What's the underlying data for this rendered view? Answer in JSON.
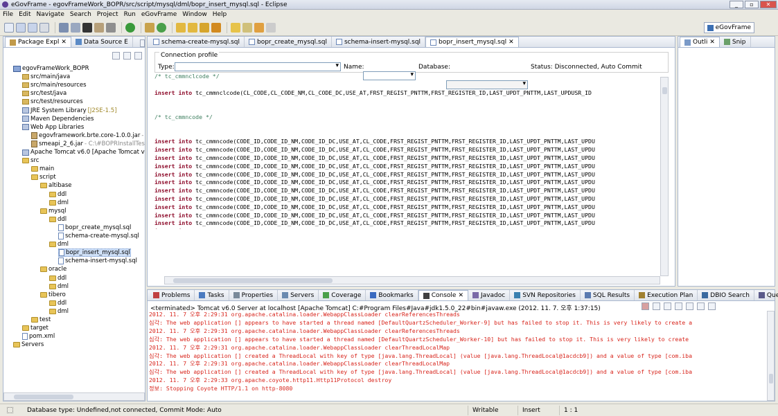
{
  "window": {
    "title": "eGovFrame - egovFrameWork_BOPR/src/script/mysql/dml/bopr_insert_mysql.sql - Eclipse"
  },
  "menu": [
    "File",
    "Edit",
    "Navigate",
    "Search",
    "Project",
    "Run",
    "eGovFrame",
    "Window",
    "Help"
  ],
  "perspective": {
    "label": "eGovFrame"
  },
  "package_explorer": {
    "tabs": [
      "Package Expl",
      "Data Source E"
    ],
    "tree": [
      {
        "label": "egovFrameWork_BOPR",
        "kind": "proj",
        "depth": 0
      },
      {
        "label": "src/main/java",
        "kind": "pkgf",
        "depth": 1
      },
      {
        "label": "src/main/resources",
        "kind": "pkgf",
        "depth": 1
      },
      {
        "label": "src/test/java",
        "kind": "pkgf",
        "depth": 1
      },
      {
        "label": "src/test/resources",
        "kind": "pkgf",
        "depth": 1
      },
      {
        "label": "JRE System Library",
        "suffix": "[J2SE-1.5]",
        "kind": "lib",
        "depth": 1
      },
      {
        "label": "Maven Dependencies",
        "kind": "lib",
        "depth": 1
      },
      {
        "label": "Web App Libraries",
        "kind": "lib",
        "depth": 1
      },
      {
        "label": "egovframework.brte.core-1.0.0.jar",
        "suffix": "- C:",
        "kind": "jar",
        "depth": 2
      },
      {
        "label": "smeapi_2_6.jar",
        "suffix": "- C:\\#BOPRInstallTest2#",
        "kind": "jar",
        "depth": 2
      },
      {
        "label": "Apache Tomcat v6.0 [Apache Tomcat v6.0",
        "kind": "lib",
        "depth": 1
      },
      {
        "label": "src",
        "kind": "folder",
        "depth": 1
      },
      {
        "label": "main",
        "kind": "folder",
        "depth": 2
      },
      {
        "label": "script",
        "kind": "folder",
        "depth": 2
      },
      {
        "label": "altibase",
        "kind": "folder",
        "depth": 3
      },
      {
        "label": "ddl",
        "kind": "folder",
        "depth": 4
      },
      {
        "label": "dml",
        "kind": "folder",
        "depth": 4
      },
      {
        "label": "mysql",
        "kind": "folder",
        "depth": 3
      },
      {
        "label": "ddl",
        "kind": "folder",
        "depth": 4
      },
      {
        "label": "bopr_create_mysql.sql",
        "kind": "sql",
        "depth": 5
      },
      {
        "label": "schema-create-mysql.sql",
        "kind": "sql",
        "depth": 5
      },
      {
        "label": "dml",
        "kind": "folder",
        "depth": 4
      },
      {
        "label": "bopr_insert_mysql.sql",
        "kind": "sql",
        "depth": 5,
        "selected": true
      },
      {
        "label": "schema-insert-mysql.sql",
        "kind": "sql",
        "depth": 5
      },
      {
        "label": "oracle",
        "kind": "folder",
        "depth": 3
      },
      {
        "label": "ddl",
        "kind": "folder",
        "depth": 4
      },
      {
        "label": "dml",
        "kind": "folder",
        "depth": 4
      },
      {
        "label": "tibero",
        "kind": "folder",
        "depth": 3
      },
      {
        "label": "ddl",
        "kind": "folder",
        "depth": 4
      },
      {
        "label": "dml",
        "kind": "folder",
        "depth": 4
      },
      {
        "label": "test",
        "kind": "folder",
        "depth": 2
      },
      {
        "label": "target",
        "kind": "folder",
        "depth": 1
      },
      {
        "label": "pom.xml",
        "kind": "sql",
        "depth": 1
      },
      {
        "label": "Servers",
        "kind": "folder",
        "depth": 0
      }
    ]
  },
  "editor": {
    "tabs": [
      "schema-create-mysql.sql",
      "bopr_create_mysql.sql",
      "schema-insert-mysql.sql",
      "bopr_insert_mysql.sql"
    ],
    "active_tab": 3,
    "connection": {
      "group_label": "Connection profile",
      "type_label": "Type:",
      "name_label": "Name:",
      "database_label": "Database:",
      "status": "Status: Disconnected, Auto Commit"
    },
    "code": [
      {
        "t": "cm",
        "s": "/* tc_cmmnclcode */"
      },
      {
        "t": "",
        "s": ""
      },
      {
        "t": "ins",
        "s": "tc_cmmnclcode(CL_CODE,CL_CODE_NM,CL_CODE_DC,USE_AT,FRST_REGIST_PNTTM,FRST_REGISTER_ID,LAST_UPDT_PNTTM,LAST_UPDUSR_ID"
      },
      {
        "t": "",
        "s": ""
      },
      {
        "t": "",
        "s": ""
      },
      {
        "t": "cm",
        "s": "/* tc_cmmncode */"
      },
      {
        "t": "",
        "s": ""
      },
      {
        "t": "",
        "s": ""
      },
      {
        "t": "ins",
        "s": "tc_cmmncode(CODE_ID,CODE_ID_NM,CODE_ID_DC,USE_AT,CL_CODE,FRST_REGIST_PNTTM,FRST_REGISTER_ID,LAST_UPDT_PNTTM,LAST_UPDU"
      },
      {
        "t": "ins",
        "s": "tc_cmmncode(CODE_ID,CODE_ID_NM,CODE_ID_DC,USE_AT,CL_CODE,FRST_REGIST_PNTTM,FRST_REGISTER_ID,LAST_UPDT_PNTTM,LAST_UPDU"
      },
      {
        "t": "ins",
        "s": "tc_cmmncode(CODE_ID,CODE_ID_NM,CODE_ID_DC,USE_AT,CL_CODE,FRST_REGIST_PNTTM,FRST_REGISTER_ID,LAST_UPDT_PNTTM,LAST_UPDU"
      },
      {
        "t": "ins",
        "s": "tc_cmmncode(CODE_ID,CODE_ID_NM,CODE_ID_DC,USE_AT,CL_CODE,FRST_REGIST_PNTTM,FRST_REGISTER_ID,LAST_UPDT_PNTTM,LAST_UPDU"
      },
      {
        "t": "ins",
        "s": "tc_cmmncode(CODE_ID,CODE_ID_NM,CODE_ID_DC,USE_AT,CL_CODE,FRST_REGIST_PNTTM,FRST_REGISTER_ID,LAST_UPDT_PNTTM,LAST_UPDU"
      },
      {
        "t": "ins",
        "s": "tc_cmmncode(CODE_ID,CODE_ID_NM,CODE_ID_DC,USE_AT,CL_CODE,FRST_REGIST_PNTTM,FRST_REGISTER_ID,LAST_UPDT_PNTTM,LAST_UPDU"
      },
      {
        "t": "ins",
        "s": "tc_cmmncode(CODE_ID,CODE_ID_NM,CODE_ID_DC,USE_AT,CL_CODE,FRST_REGIST_PNTTM,FRST_REGISTER_ID,LAST_UPDT_PNTTM,LAST_UPDU"
      },
      {
        "t": "ins",
        "s": "tc_cmmncode(CODE_ID,CODE_ID_NM,CODE_ID_DC,USE_AT,CL_CODE,FRST_REGIST_PNTTM,FRST_REGISTER_ID,LAST_UPDT_PNTTM,LAST_UPDU"
      },
      {
        "t": "ins",
        "s": "tc_cmmncode(CODE_ID,CODE_ID_NM,CODE_ID_DC,USE_AT,CL_CODE,FRST_REGIST_PNTTM,FRST_REGISTER_ID,LAST_UPDT_PNTTM,LAST_UPDU"
      },
      {
        "t": "ins",
        "s": "tc_cmmncode(CODE_ID,CODE_ID_NM,CODE_ID_DC,USE_AT,CL_CODE,FRST_REGIST_PNTTM,FRST_REGISTER_ID,LAST_UPDT_PNTTM,LAST_UPDU"
      },
      {
        "t": "ins",
        "s": "tc_cmmncode(CODE_ID,CODE_ID_NM,CODE_ID_DC,USE_AT,CL_CODE,FRST_REGIST_PNTTM,FRST_REGISTER_ID,LAST_UPDT_PNTTM,LAST_UPDU"
      },
      {
        "t": "ins",
        "s": "tc_cmmncode(CODE_ID,CODE_ID_NM,CODE_ID_DC,USE_AT,CL_CODE,FRST_REGIST_PNTTM,FRST_REGISTER_ID,LAST_UPDT_PNTTM,LAST_UPDU"
      },
      {
        "t": "ins",
        "s": "tc_cmmncode(CODE_ID,CODE_ID_NM,CODE_ID_DC,USE_AT,CL_CODE,FRST_REGIST_PNTTM,FRST_REGISTER_ID,LAST_UPDT_PNTTM,LAST_UPDU"
      },
      {
        "t": "ins",
        "s": "tc_cmmncode(CODE_ID,CODE_ID_NM,CODE_ID_DC,USE_AT,CL_CODE,FRST_REGIST_PNTTM,FRST_REGISTER_ID,LAST_UPDT_PNTTM,LAST_UPDU"
      },
      {
        "t": "ins",
        "s": "tc_cmmncode(CODE_ID,CODE_ID_NM,CODE_ID_DC,USE_AT,CL_CODE,FRST_REGIST_PNTTM,FRST_REGISTER_ID,LAST_UPDT_PNTTM,LAST_UPDU"
      }
    ],
    "keyword": "insert into"
  },
  "outline": {
    "tabs": [
      "Outli",
      "Snip"
    ]
  },
  "bottom": {
    "tabs": [
      "Problems",
      "Tasks",
      "Properties",
      "Servers",
      "Coverage",
      "Bookmarks",
      "Console",
      "Javadoc",
      "SVN Repositories",
      "SQL Results",
      "Execution Plan",
      "DBIO Search",
      "Query Result"
    ],
    "active_tab": 6,
    "console_header": "<terminated> Tomcat v6.0 Server at localhost [Apache Tomcat] C:#Program Files#Java#jdk1.5.0_22#bin#javaw.exe (2012. 11. 7. 오후 1:37:15)",
    "console_lines": [
      "2012. 11. 7 오후 2:29:31 org.apache.catalina.loader.WebappClassLoader clearReferencesThreads",
      "심각: The web application [] appears to have started a thread named [DefaultQuartzScheduler_Worker-9] but has failed to stop it. This is very likely to create a",
      "2012. 11. 7 오후 2:29:31 org.apache.catalina.loader.WebappClassLoader clearReferencesThreads",
      "심각: The web application [] appears to have started a thread named [DefaultQuartzScheduler_Worker-10] but has failed to stop it. This is very likely to create",
      "2012. 11. 7 오후 2:29:31 org.apache.catalina.loader.WebappClassLoader clearThreadLocalMap",
      "심각: The web application [] created a ThreadLocal with key of type [java.lang.ThreadLocal] (value [java.lang.ThreadLocal@1acdcb9]) and a value of type [com.iba",
      "2012. 11. 7 오후 2:29:31 org.apache.catalina.loader.WebappClassLoader clearThreadLocalMap",
      "심각: The web application [] created a ThreadLocal with key of type [java.lang.ThreadLocal] (value [java.lang.ThreadLocal@1acdcb9]) and a value of type [com.iba",
      "2012. 11. 7 오후 2:29:33 org.apache.coyote.http11.Http11Protocol destroy",
      "정보: Stopping Coyote HTTP/1.1 on http-8080"
    ]
  },
  "status": {
    "db": "Database type: Undefined,not connected, Commit Mode: Auto",
    "writable": "Writable",
    "insert": "Insert",
    "position": "1 : 1"
  },
  "colors": {
    "keyword": "#8e0c2b",
    "comment": "#3e7f5f",
    "console_error": "#d8251c",
    "selection": "#cfe0f7"
  }
}
